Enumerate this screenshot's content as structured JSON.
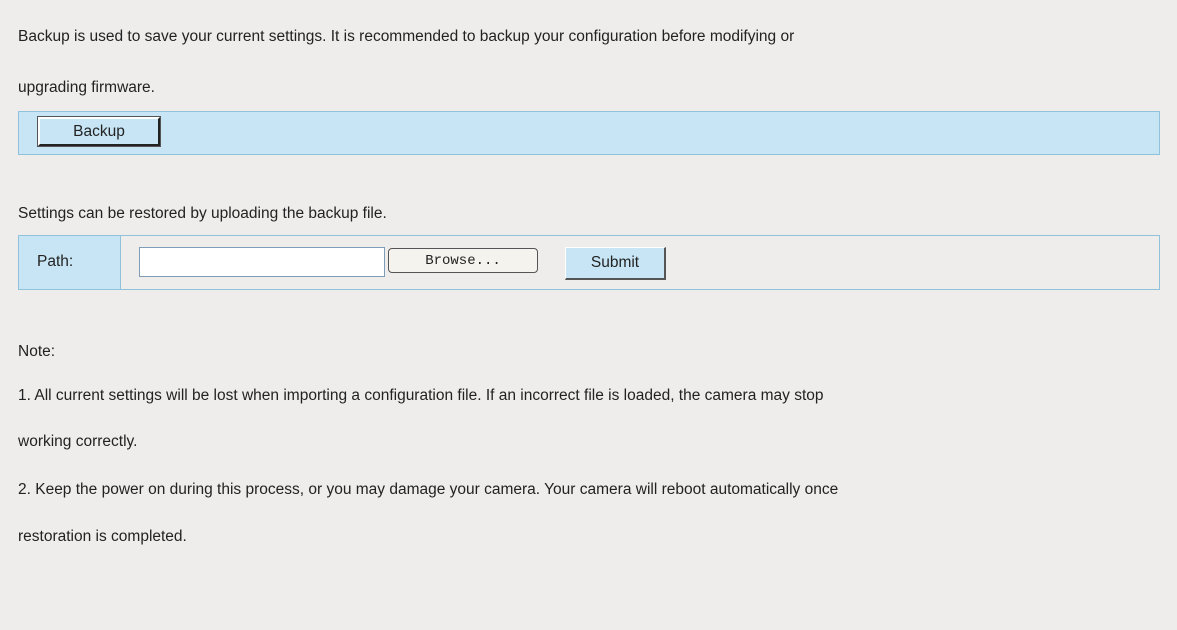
{
  "backup": {
    "description_line1": "Backup is used to save your current settings. It is recommended to backup your configuration before modifying or",
    "description_line2": "upgrading firmware.",
    "button_label": "Backup"
  },
  "restore": {
    "description": "Settings can be restored by uploading the backup file.",
    "path_label": "Path:",
    "path_value": "",
    "browse_label": "Browse...",
    "submit_label": "Submit"
  },
  "notes": {
    "heading": "Note:",
    "note1_line1": "1. All current settings will be lost when importing a configuration file. If an incorrect file is loaded, the camera may stop",
    "note1_line2": "working correctly.",
    "note2_line1": "2. Keep the power on during this process, or you may damage your camera. Your camera will reboot automatically once",
    "note2_line2": "restoration is completed."
  },
  "colors": {
    "panel_background": "#eeedec",
    "highlight_bar": "#c7e5f4",
    "bar_border": "#8fc3dc"
  }
}
